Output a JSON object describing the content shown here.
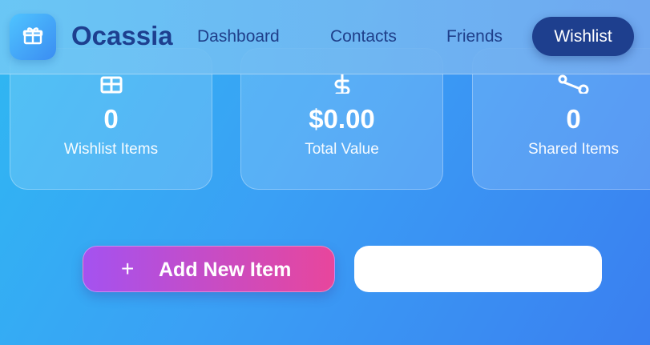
{
  "header": {
    "brand": "Ocassia",
    "nav": [
      {
        "label": "Dashboard"
      },
      {
        "label": "Contacts"
      },
      {
        "label": "Friends"
      },
      {
        "label": "Wishlist",
        "active": true
      }
    ]
  },
  "stats": [
    {
      "value": "0",
      "label": "Wishlist Items",
      "icon": "gift-icon"
    },
    {
      "value": "$0.00",
      "label": "Total Value",
      "icon": "dollar-icon"
    },
    {
      "value": "0",
      "label": "Shared Items",
      "icon": "share-icon"
    }
  ],
  "actions": {
    "add_label": "Add New Item",
    "add_icon": "plus-icon",
    "search_value": ""
  },
  "colors": {
    "brand_text": "#1d3f8f",
    "active_nav": "#1e3f8e",
    "add_gradient_start": "#a452f0",
    "add_gradient_end": "#e8469c"
  }
}
